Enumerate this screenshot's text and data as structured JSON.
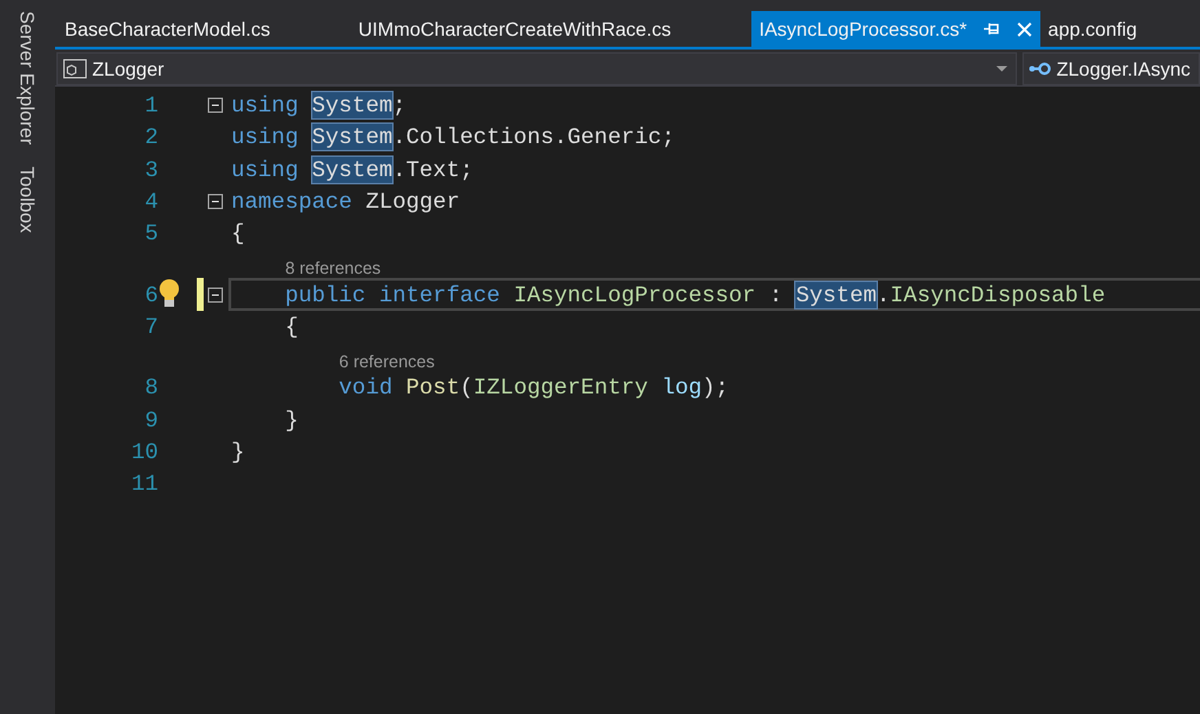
{
  "side_tabs": [
    {
      "label": "Server Explorer"
    },
    {
      "label": "Toolbox"
    }
  ],
  "tabs": [
    {
      "label": "BaseCharacterModel.cs",
      "selected": false
    },
    {
      "label": "UIMmoCharacterCreateWithRace.cs",
      "selected": false
    },
    {
      "label": "IAsyncLogProcessor.cs*",
      "selected": true
    },
    {
      "label": "app.config",
      "selected": false
    }
  ],
  "nav_bar": {
    "project": "ZLogger",
    "member": "ZLogger.IAsync"
  },
  "lines": [
    {
      "number": "1",
      "fold": true,
      "lightbulb": false,
      "changed": false,
      "current": false,
      "tokens": [
        {
          "kind": "keyword",
          "text": "using "
        },
        {
          "kind": "highlight",
          "text": "System"
        },
        {
          "kind": "plain",
          "text": ";"
        }
      ]
    },
    {
      "number": "2",
      "fold": false,
      "lightbulb": false,
      "changed": false,
      "current": false,
      "tokens": [
        {
          "kind": "keyword",
          "text": "using "
        },
        {
          "kind": "highlight",
          "text": "System"
        },
        {
          "kind": "plain",
          "text": ".Collections.Generic;"
        }
      ]
    },
    {
      "number": "3",
      "fold": false,
      "lightbulb": false,
      "changed": false,
      "current": false,
      "tokens": [
        {
          "kind": "keyword",
          "text": "using "
        },
        {
          "kind": "highlight",
          "text": "System"
        },
        {
          "kind": "plain",
          "text": ".Text;"
        }
      ]
    },
    {
      "number": "4",
      "fold": true,
      "lightbulb": false,
      "changed": false,
      "current": false,
      "tokens": [
        {
          "kind": "keyword",
          "text": "namespace"
        },
        {
          "kind": "plain",
          "text": " ZLogger"
        }
      ]
    },
    {
      "number": "5",
      "fold": false,
      "lightbulb": false,
      "changed": false,
      "current": false,
      "tokens": [
        {
          "kind": "plain",
          "text": "{"
        }
      ]
    },
    {
      "number": "6",
      "fold": true,
      "lightbulb": true,
      "changed": true,
      "current": true,
      "references": "8 references",
      "tokens": [
        {
          "kind": "keyword",
          "text": "    public interface "
        },
        {
          "kind": "type",
          "text": "IAsyncLogProcessor"
        },
        {
          "kind": "plain",
          "text": " : "
        },
        {
          "kind": "highlight",
          "text": "System"
        },
        {
          "kind": "plain",
          "text": "."
        },
        {
          "kind": "type",
          "text": "IAsyncDisposable"
        }
      ]
    },
    {
      "number": "7",
      "fold": false,
      "lightbulb": false,
      "changed": false,
      "current": false,
      "tokens": [
        {
          "kind": "plain",
          "text": "    {"
        }
      ]
    },
    {
      "number": "8",
      "fold": false,
      "lightbulb": false,
      "changed": false,
      "current": false,
      "references": "6 references",
      "tokens": [
        {
          "kind": "keyword",
          "text": "        void "
        },
        {
          "kind": "method",
          "text": "Post"
        },
        {
          "kind": "plain",
          "text": "("
        },
        {
          "kind": "type",
          "text": "IZLoggerEntry "
        },
        {
          "kind": "param",
          "text": "log"
        },
        {
          "kind": "plain",
          "text": ");"
        }
      ]
    },
    {
      "number": "9",
      "fold": false,
      "lightbulb": false,
      "changed": false,
      "current": false,
      "tokens": [
        {
          "kind": "plain",
          "text": "    }"
        }
      ]
    },
    {
      "number": "10",
      "fold": false,
      "lightbulb": false,
      "changed": false,
      "current": false,
      "tokens": [
        {
          "kind": "plain",
          "text": "}"
        }
      ]
    },
    {
      "number": "11",
      "fold": false,
      "lightbulb": false,
      "changed": false,
      "current": false
    }
  ]
}
